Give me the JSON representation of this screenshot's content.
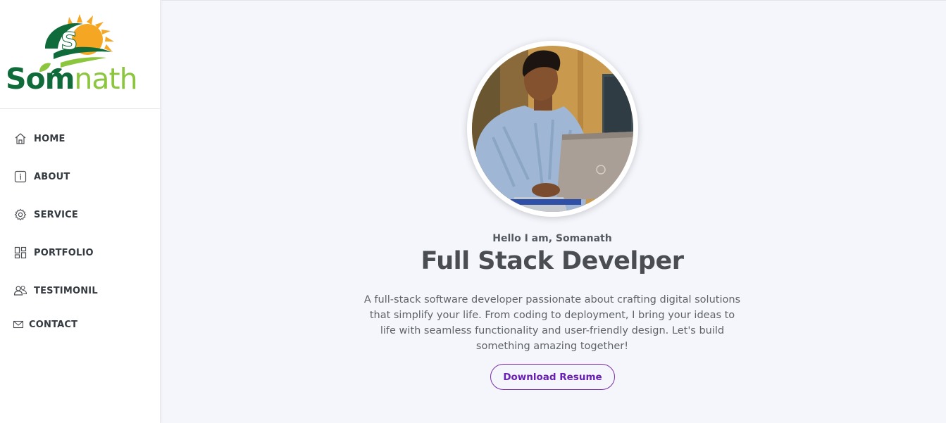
{
  "brand": {
    "logo_part1": "Som",
    "logo_part2": "nath",
    "colors": {
      "dark_green": "#0f6b3a",
      "light_green": "#8cc63f",
      "sun": "#f5a623"
    }
  },
  "nav": {
    "items": [
      {
        "label": "HOME",
        "icon": "home-icon"
      },
      {
        "label": "ABOUT",
        "icon": "info-icon"
      },
      {
        "label": "SERVICE",
        "icon": "gear-icon"
      },
      {
        "label": "PORTFOLIO",
        "icon": "grid-icon"
      },
      {
        "label": "TESTIMONIL",
        "icon": "users-icon"
      },
      {
        "label": "CONTACT",
        "icon": "envelope-icon"
      }
    ]
  },
  "hero": {
    "greeting": "Hello I am, Somanath",
    "title": "Full Stack Develper",
    "bio": "A full-stack software developer passionate about crafting digital solutions that simplify your life. From coding to deployment, I bring your ideas to life with seamless functionality and user-friendly design. Let's build something amazing together!",
    "button_label": "Download Resume",
    "accent_color": "#6a1fb5"
  }
}
